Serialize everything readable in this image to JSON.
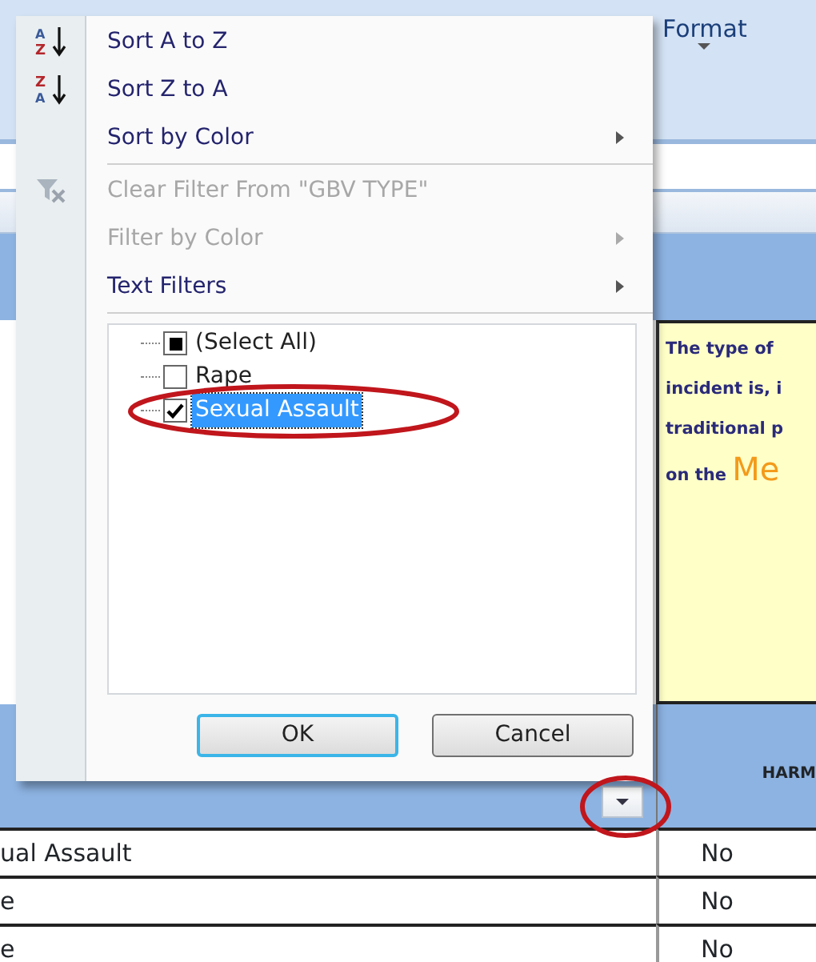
{
  "ribbon": {
    "format_button": {
      "label": "Format"
    }
  },
  "menu": {
    "items": [
      {
        "kind": "sort",
        "label": "Sort A to Z",
        "icon_text": [
          "A",
          "Z"
        ],
        "disabled": false,
        "submenu": false
      },
      {
        "kind": "sort",
        "label": "Sort Z to A",
        "icon_text": [
          "Z",
          "A"
        ],
        "disabled": false,
        "submenu": false
      },
      {
        "kind": "command",
        "label": "Sort by Color",
        "disabled": false,
        "submenu": true
      },
      {
        "kind": "separator"
      },
      {
        "kind": "clear",
        "label": "Clear Filter From \"GBV TYPE\"",
        "disabled": true,
        "submenu": false
      },
      {
        "kind": "command",
        "label": "Filter by Color",
        "disabled": true,
        "submenu": true
      },
      {
        "kind": "command",
        "label": "Text Filters",
        "disabled": false,
        "submenu": true
      },
      {
        "kind": "separator"
      }
    ],
    "checklist": [
      {
        "label": "(Select All)",
        "checked": false,
        "indeterminate": true,
        "selected": false
      },
      {
        "label": "Rape",
        "checked": false,
        "indeterminate": false,
        "selected": false
      },
      {
        "label": "Sexual Assault",
        "checked": true,
        "indeterminate": false,
        "selected": true
      }
    ],
    "buttons": [
      {
        "label": "OK",
        "default": true
      },
      {
        "label": "Cancel",
        "default": false
      }
    ]
  },
  "note": {
    "lines": [
      {
        "text": "The type of"
      },
      {
        "text": "incident is, i"
      },
      {
        "text": "traditional p"
      },
      {
        "text": "on the",
        "emphasis": "Me"
      }
    ]
  },
  "header": {
    "column_2": "HARM"
  },
  "rows": [
    {
      "column_1": "ual Assault",
      "column_2": "No"
    },
    {
      "column_1": "e",
      "column_2": "No"
    },
    {
      "column_1": "e",
      "column_2": "No"
    }
  ]
}
